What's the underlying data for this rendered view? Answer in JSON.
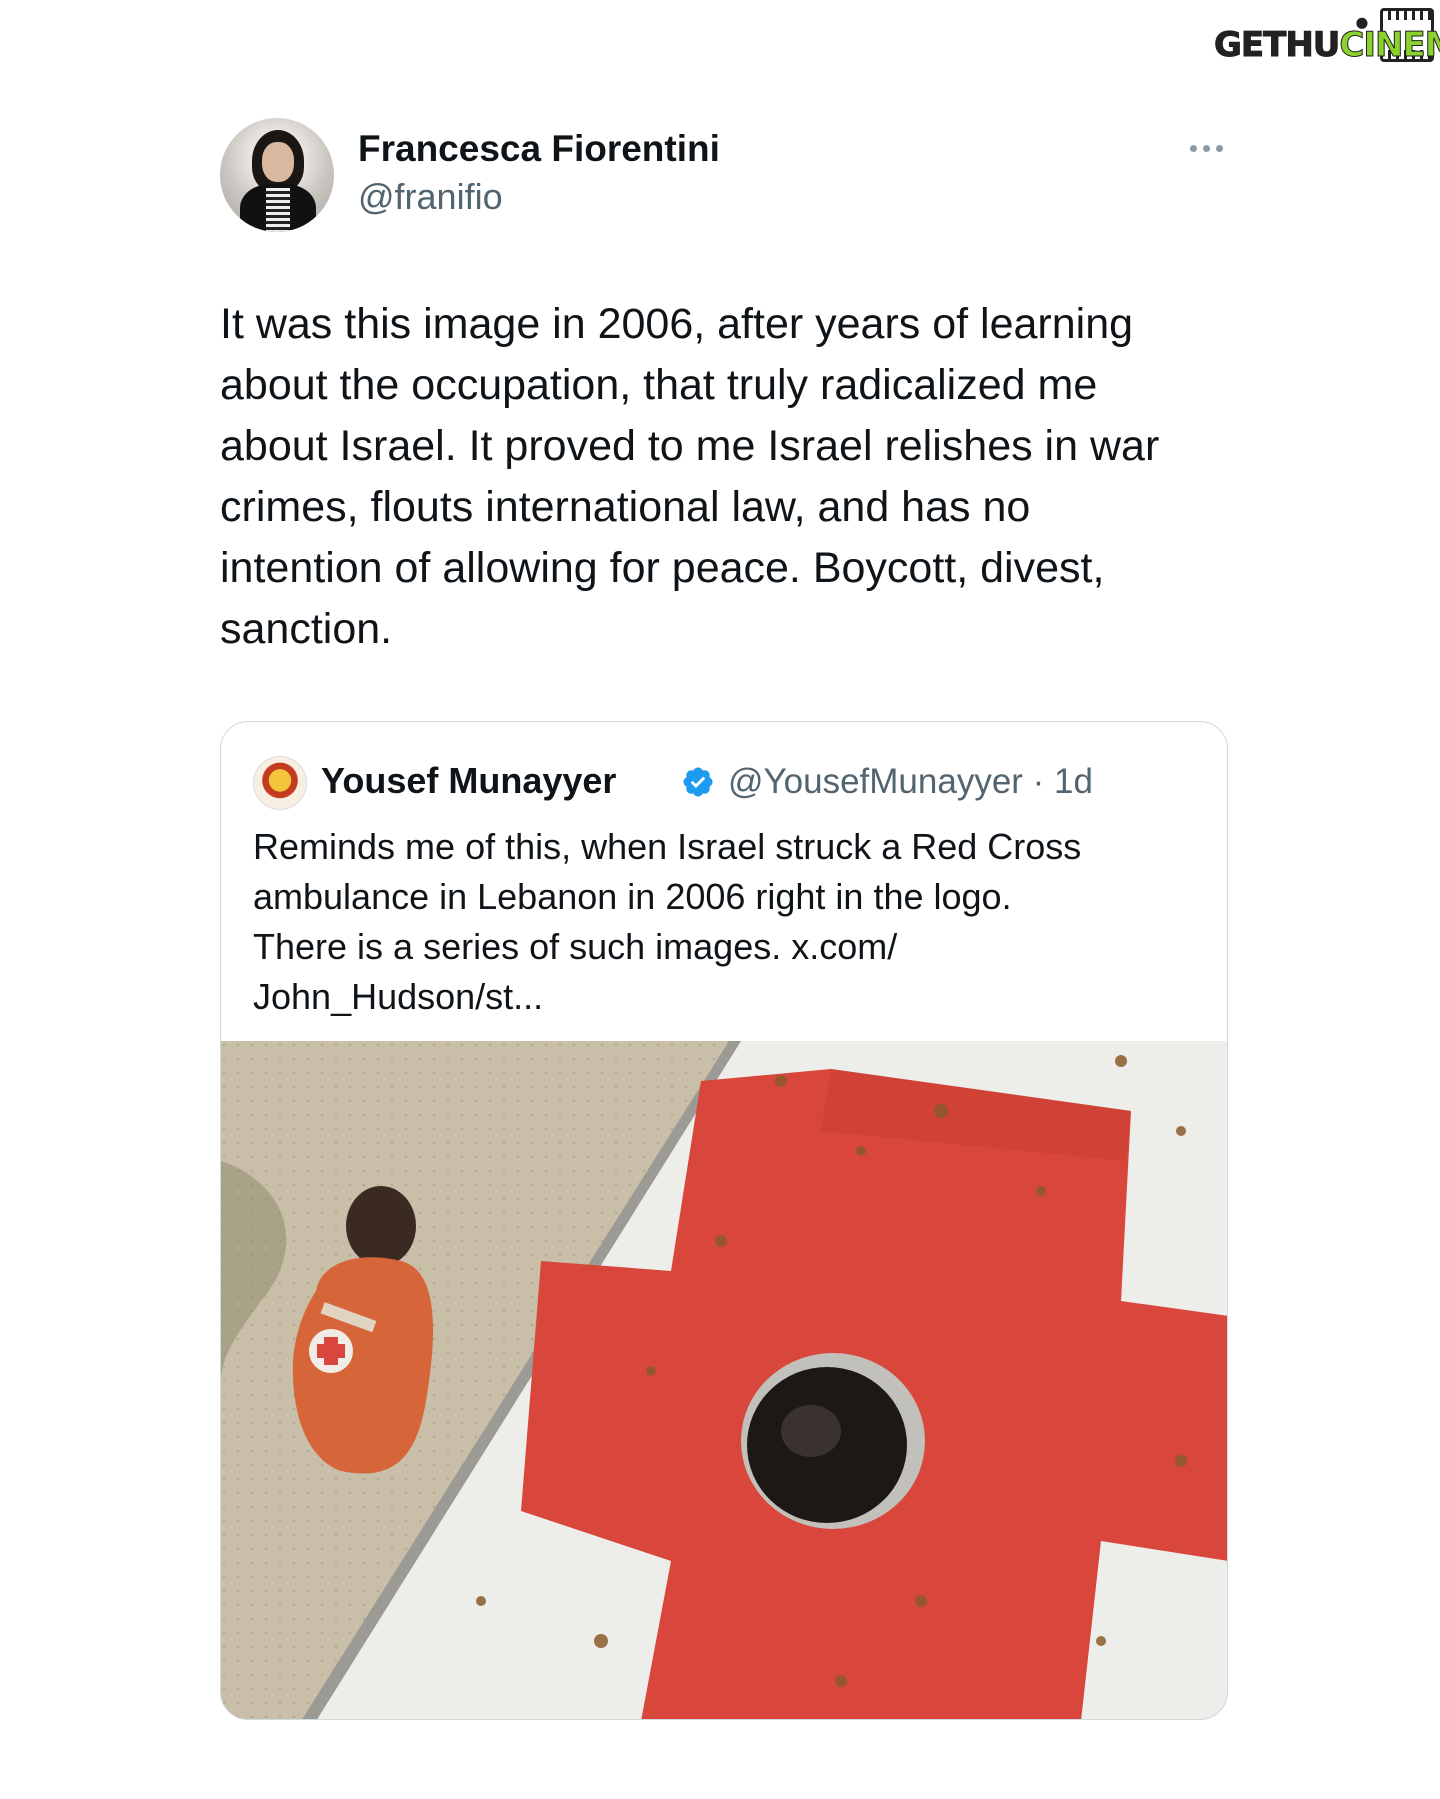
{
  "watermark": {
    "part1": "GETHU",
    "part2": "CINEMA"
  },
  "tweet": {
    "author_name": "Francesca Fiorentini",
    "author_handle": "@franifio",
    "text": "It was this image in 2006, after years of learning\nabout the occupation, that truly radicalized me\nabout Israel. It proved to me Israel relishes in war\ncrimes, flouts international law, and has no\nintention of allowing for peace. Boycott, divest,\nsanction."
  },
  "quoted": {
    "author_name": "Yousef Munayyer",
    "author_handle": "@YousefMunayyer · 1d",
    "text": "Reminds me of this, when Israel struck a Red Cross\nambulance in Lebanon in 2006 right in the logo.\nThere is a series of such images. x.com/\nJohn_Hudson/st..."
  },
  "colors": {
    "text": "#0f1419",
    "secondary": "#536471",
    "border": "#cfd9de",
    "verified": "#1d9bf0",
    "cross_red": "#d9473c",
    "watermark_green": "#8bd32c"
  },
  "icons": {
    "more": "more-horizontal-icon",
    "verified": "verified-badge-icon"
  }
}
